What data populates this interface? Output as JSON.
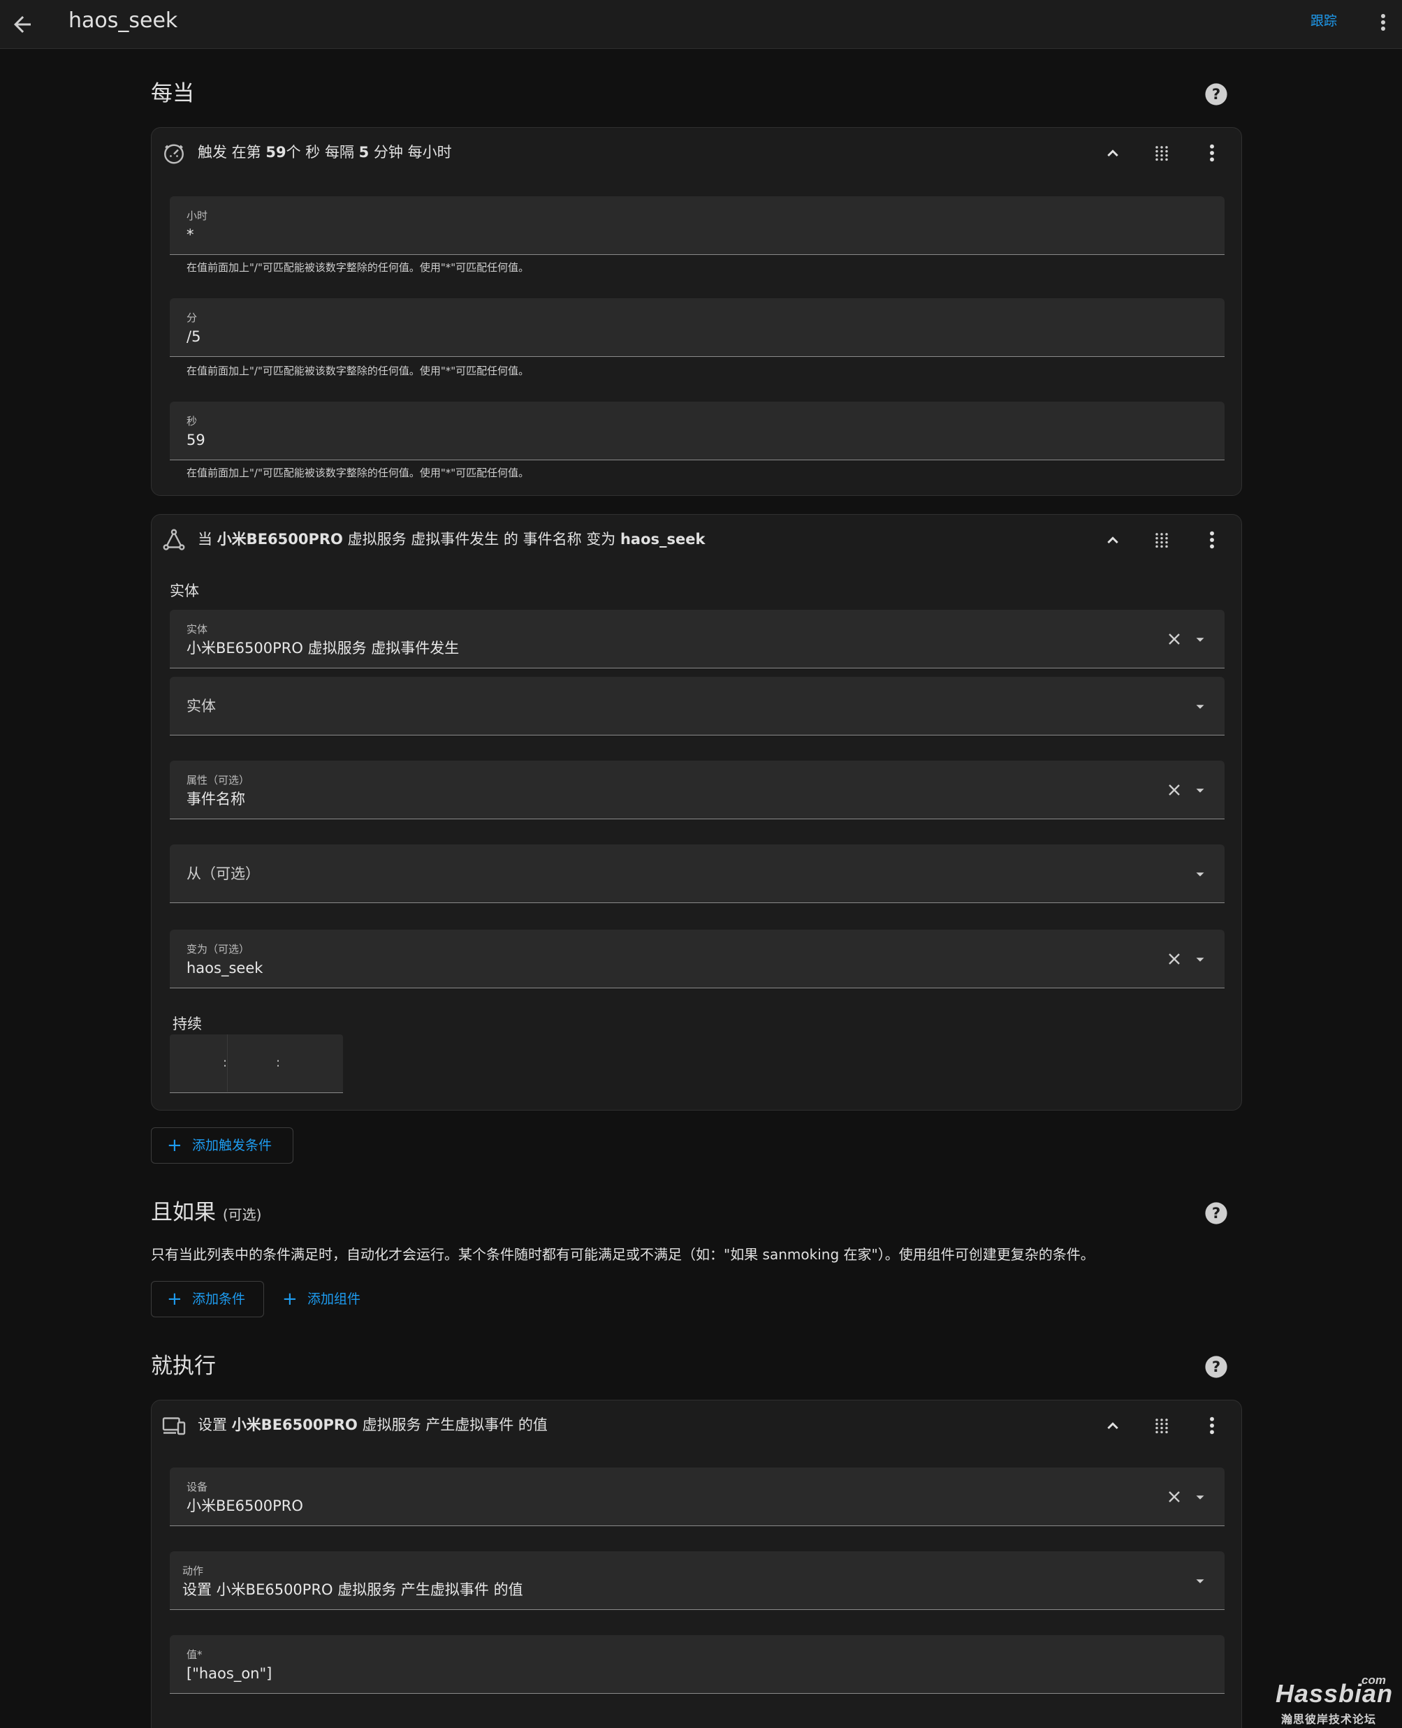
{
  "header": {
    "title": "haos_seek",
    "follow_label": "跟踪"
  },
  "triggers_section": {
    "title": "每当"
  },
  "time_trigger": {
    "prefix": "触发 在第 ",
    "second": "59",
    "mid1": "个 秒 每隔 ",
    "minute": "5",
    "mid2": " 分钟 每小时",
    "fields": [
      {
        "label": "小时",
        "value": "*",
        "helper": "在值前面加上\"/\"可匹配能被该数字整除的任何值。使用\"*\"可匹配任何值。"
      },
      {
        "label": "分",
        "value": "/5",
        "helper": "在值前面加上\"/\"可匹配能被该数字整除的任何值。使用\"*\"可匹配任何值。"
      },
      {
        "label": "秒",
        "value": "59",
        "helper": "在值前面加上\"/\"可匹配能被该数字整除的任何值。使用\"*\"可匹配任何值。"
      }
    ]
  },
  "state_trigger": {
    "prefix": "当 ",
    "entity": "小米BE6500PRO",
    "mid": " 虚拟服务 虚拟事件发生 的 事件名称 变为 ",
    "to": "haos_seek",
    "entity_section_label": "实体",
    "entity_field": {
      "label": "实体",
      "value": "小米BE6500PRO  虚拟服务 虚拟事件发生"
    },
    "entity_add_placeholder": "实体",
    "attribute_field": {
      "label": "属性（可选）",
      "value": "事件名称"
    },
    "from_placeholder": "从（可选）",
    "to_field": {
      "label": "变为（可选）",
      "value": "haos_seek"
    },
    "duration_label": "持续",
    "duration_sep1": ":",
    "duration_sep2": ":"
  },
  "add_trigger_label": "添加触发条件",
  "conditions_section": {
    "title": "且如果",
    "optional": "(可选)",
    "description": "只有当此列表中的条件满足时，自动化才会运行。某个条件随时都有可能满足或不满足（如：\"如果 sanmoking 在家\"）。使用组件可创建更复杂的条件。",
    "add_condition_label": "添加条件",
    "add_block_label": "添加组件"
  },
  "actions_section": {
    "title": "就执行"
  },
  "device_action": {
    "prefix": "设置 ",
    "device": "小米BE6500PRO",
    "suffix": " 虚拟服务 产生虚拟事件 的值",
    "device_field": {
      "label": "设备",
      "value": "小米BE6500PRO"
    },
    "action_field": {
      "label": "动作",
      "value": "设置 小米BE6500PRO 虚拟服务 产生虚拟事件 的值"
    },
    "value_field": {
      "label": "值*",
      "value": "[\"haos_on\"]"
    }
  },
  "watermark": {
    "com": "com",
    "main": "Hassbian",
    "sub": "瀚思彼岸技术论坛"
  },
  "colors": {
    "accent": "#1e9cf0",
    "background": "#111111",
    "card": "#1c1c1c",
    "field": "#2a2a2a"
  }
}
